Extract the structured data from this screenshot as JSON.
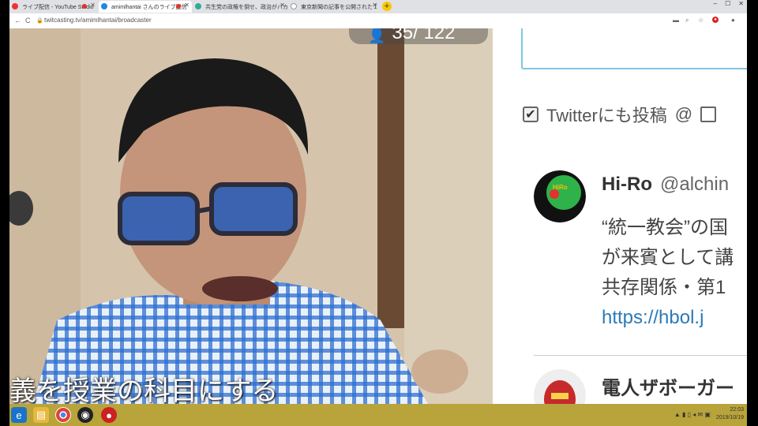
{
  "browser": {
    "tabs": [
      {
        "label": "ライブ配信 - YouTube Studio",
        "active": false,
        "recording": true
      },
      {
        "label": "amimlhantai さんのライブ配信",
        "active": true,
        "recording": true
      },
      {
        "label": "共生党の政権を倒せ、政治がバカに",
        "active": false,
        "recording": false
      },
      {
        "label": "東京新聞の記事を公開されたＩ",
        "active": false,
        "recording": false
      }
    ],
    "new_tab_label": "+",
    "window_controls": [
      "–",
      "☐",
      "✕"
    ],
    "url": "twitcasting.tv/amimlhantai/broadcaster",
    "nav": {
      "back": "←",
      "reload": "C"
    }
  },
  "video": {
    "viewer_count": "35/ 122",
    "subtitle": "義を授業の科目にする"
  },
  "sidebar": {
    "twitter_post_label": "Twitterにも投稿",
    "at_icon": "@",
    "tweets": [
      {
        "name": "Hi-Ro",
        "handle": "@alchin",
        "lines": [
          "“統一教会”の国",
          "が来賓として講",
          "共存関係・第1"
        ],
        "link": "https://hbol.j"
      },
      {
        "name": "電人ザボーガー",
        "handle": "",
        "lines": [],
        "link": ""
      }
    ]
  },
  "taskbar": {
    "time": "22:03",
    "date": "2019/10/19",
    "apps": [
      "ie-icon",
      "explorer-icon",
      "chrome-icon",
      "obs-icon",
      "recorder-icon"
    ]
  },
  "colors": {
    "accent_link": "#2b7bb9",
    "textarea_border": "#7fc6e4",
    "taskbar": "#b8a43a"
  }
}
